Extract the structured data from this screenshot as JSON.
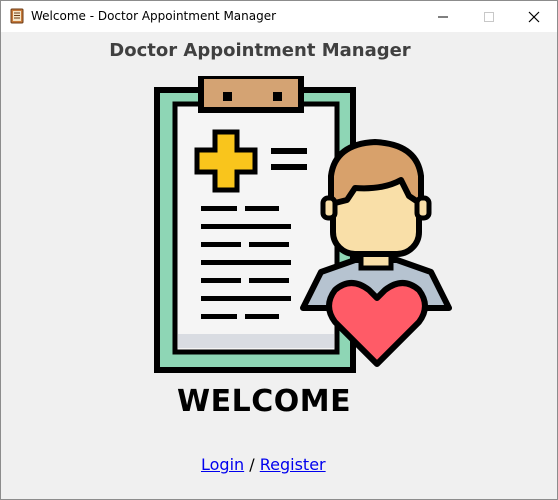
{
  "window": {
    "title": "Welcome - Doctor Appointment Manager",
    "icon": "notebook-app-icon",
    "controls": [
      "minimize-icon",
      "maximize-icon",
      "close-icon"
    ]
  },
  "header": {
    "title": "Doctor Appointment Manager"
  },
  "illustration": {
    "icon": "clipboard-doctor-heart-illustration",
    "colors": {
      "clip": "#D4A373",
      "board_border": "#8ED6B5",
      "cross": "#F9C51C",
      "hair": "#D8A16B",
      "skin": "#F9DFA8",
      "shirt": "#B6C3D0",
      "heart": "#FF5B67"
    }
  },
  "main": {
    "welcome": "WELCOME",
    "login_link": "Login",
    "separator": "/",
    "register_link": "Register"
  }
}
